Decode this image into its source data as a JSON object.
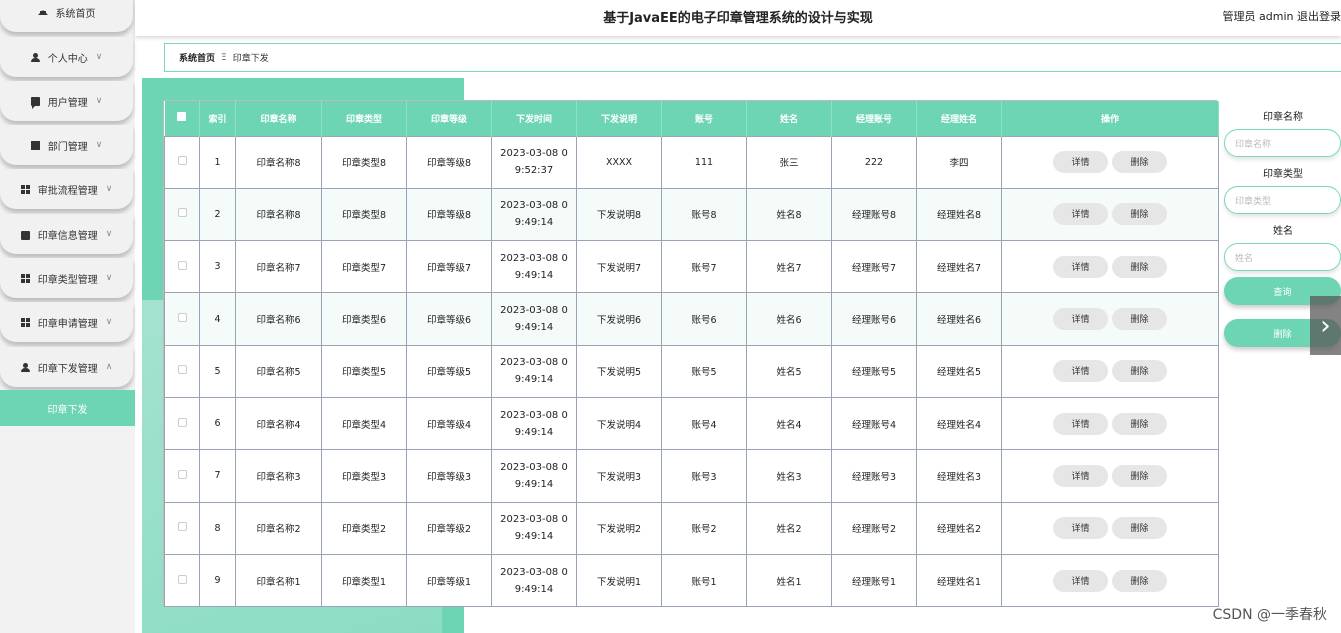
{
  "header": {
    "title": "基于JavaEE的电子印章管理系统的设计与实现",
    "user": "管理员 admin  退出登录"
  },
  "sidebar": {
    "items": [
      {
        "label": "系统首页",
        "icon": "home-icon",
        "chevron": ""
      },
      {
        "label": "个人中心",
        "icon": "user-icon",
        "chevron": "∨"
      },
      {
        "label": "用户管理",
        "icon": "chat-icon",
        "chevron": "∨"
      },
      {
        "label": "部门管理",
        "icon": "desktop-icon",
        "chevron": "∨"
      },
      {
        "label": "审批流程管理",
        "icon": "grid-icon",
        "chevron": "∨"
      },
      {
        "label": "印章信息管理",
        "icon": "box-icon",
        "chevron": "∨"
      },
      {
        "label": "印章类型管理",
        "icon": "grid-icon",
        "chevron": "∨"
      },
      {
        "label": "印章申请管理",
        "icon": "grid-icon",
        "chevron": "∨"
      },
      {
        "label": "印章下发管理",
        "icon": "user-icon",
        "chevron": "∧"
      }
    ],
    "active_sub": "印章下发"
  },
  "breadcrumb": {
    "home": "系统首页",
    "sep": "Ξ",
    "current": "印章下发"
  },
  "table": {
    "columns": [
      "",
      "索引",
      "印章名称",
      "印章类型",
      "印章等级",
      "下发时间",
      "下发说明",
      "账号",
      "姓名",
      "经理账号",
      "经理姓名",
      "操作"
    ],
    "rows": [
      {
        "idx": "1",
        "name": "印章名称8",
        "type": "印章类型8",
        "level": "印章等级8",
        "time1": "2023-03-08 0",
        "time2": "9:52:37",
        "desc": "XXXX",
        "account": "111",
        "person": "张三",
        "mgr_account": "222",
        "mgr_name": "李四"
      },
      {
        "idx": "2",
        "name": "印章名称8",
        "type": "印章类型8",
        "level": "印章等级8",
        "time1": "2023-03-08 0",
        "time2": "9:49:14",
        "desc": "下发说明8",
        "account": "账号8",
        "person": "姓名8",
        "mgr_account": "经理账号8",
        "mgr_name": "经理姓名8"
      },
      {
        "idx": "3",
        "name": "印章名称7",
        "type": "印章类型7",
        "level": "印章等级7",
        "time1": "2023-03-08 0",
        "time2": "9:49:14",
        "desc": "下发说明7",
        "account": "账号7",
        "person": "姓名7",
        "mgr_account": "经理账号7",
        "mgr_name": "经理姓名7"
      },
      {
        "idx": "4",
        "name": "印章名称6",
        "type": "印章类型6",
        "level": "印章等级6",
        "time1": "2023-03-08 0",
        "time2": "9:49:14",
        "desc": "下发说明6",
        "account": "账号6",
        "person": "姓名6",
        "mgr_account": "经理账号6",
        "mgr_name": "经理姓名6"
      },
      {
        "idx": "5",
        "name": "印章名称5",
        "type": "印章类型5",
        "level": "印章等级5",
        "time1": "2023-03-08 0",
        "time2": "9:49:14",
        "desc": "下发说明5",
        "account": "账号5",
        "person": "姓名5",
        "mgr_account": "经理账号5",
        "mgr_name": "经理姓名5"
      },
      {
        "idx": "6",
        "name": "印章名称4",
        "type": "印章类型4",
        "level": "印章等级4",
        "time1": "2023-03-08 0",
        "time2": "9:49:14",
        "desc": "下发说明4",
        "account": "账号4",
        "person": "姓名4",
        "mgr_account": "经理账号4",
        "mgr_name": "经理姓名4"
      },
      {
        "idx": "7",
        "name": "印章名称3",
        "type": "印章类型3",
        "level": "印章等级3",
        "time1": "2023-03-08 0",
        "time2": "9:49:14",
        "desc": "下发说明3",
        "account": "账号3",
        "person": "姓名3",
        "mgr_account": "经理账号3",
        "mgr_name": "经理姓名3"
      },
      {
        "idx": "8",
        "name": "印章名称2",
        "type": "印章类型2",
        "level": "印章等级2",
        "time1": "2023-03-08 0",
        "time2": "9:49:14",
        "desc": "下发说明2",
        "account": "账号2",
        "person": "姓名2",
        "mgr_account": "经理账号2",
        "mgr_name": "经理姓名2"
      },
      {
        "idx": "9",
        "name": "印章名称1",
        "type": "印章类型1",
        "level": "印章等级1",
        "time1": "2023-03-08 0",
        "time2": "9:49:14",
        "desc": "下发说明1",
        "account": "账号1",
        "person": "姓名1",
        "mgr_account": "经理账号1",
        "mgr_name": "经理姓名1"
      }
    ],
    "detail_label": "详情",
    "delete_label": "删除"
  },
  "search": {
    "name_label": "印章名称",
    "name_placeholder": "印章名称",
    "type_label": "印章类型",
    "type_placeholder": "印章类型",
    "person_label": "姓名",
    "person_placeholder": "姓名",
    "query_label": "查询",
    "delete_label": "删除"
  },
  "watermark": "CSDN @一季春秋",
  "colors": {
    "accent": "#6dd4b4",
    "button_gray": "#e6e6e6"
  }
}
